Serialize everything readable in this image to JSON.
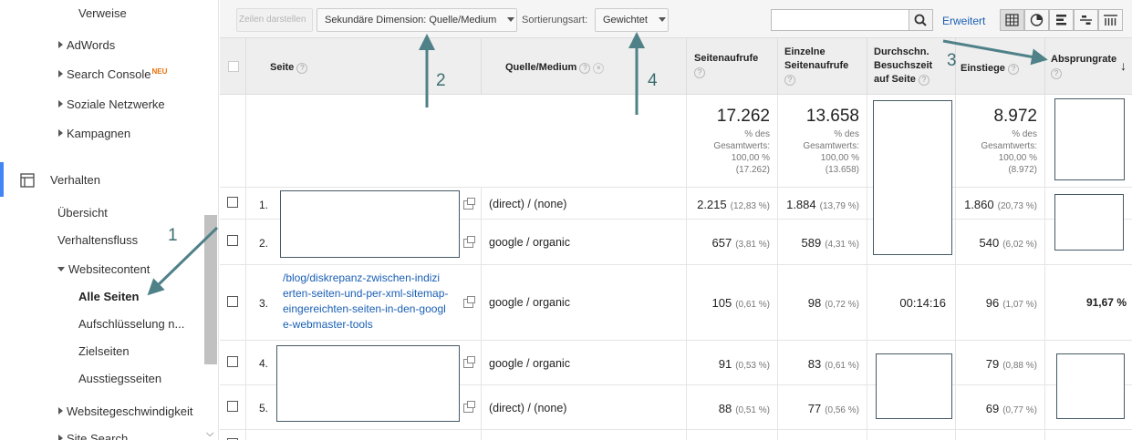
{
  "sidebar": {
    "verweise": "Verweise",
    "adwords": "AdWords",
    "search_console": "Search Console",
    "search_console_badge": "NEU",
    "soziale": "Soziale Netzwerke",
    "kampagnen": "Kampagnen",
    "verhalten": "Verhalten",
    "uebersicht": "Übersicht",
    "verhaltensfluss": "Verhaltensfluss",
    "websitecontent": "Websitecontent",
    "alle_seiten": "Alle Seiten",
    "aufschluesselung": "Aufschlüsselung n...",
    "zielseiten": "Zielseiten",
    "ausstiegsseiten": "Ausstiegsseiten",
    "geschwindigkeit": "Websitegeschwindigkeit",
    "site_search": "Site Search"
  },
  "toolbar": {
    "zeilen": "Zeilen darstellen",
    "sekundaer": "Sekundäre Dimension: Quelle/Medium",
    "sortierungsart_label": "Sortierungsart:",
    "gewichtet": "Gewichtet",
    "search_value": "",
    "erweitert": "Erweitert"
  },
  "table": {
    "headers": {
      "seite": "Seite",
      "quelle": "Quelle/Medium",
      "seitenaufrufe": "Seitenaufrufe",
      "einzelne_1": "Einzelne",
      "einzelne_2": "Seitenaufrufe",
      "durch_1": "Durchschn.",
      "durch_2": "Besuchszeit",
      "durch_3": "auf Seite",
      "einstiege": "Einstiege",
      "absprung": "Absprungrate"
    },
    "totals": {
      "seitenaufrufe": "17.262",
      "einzelne": "13.658",
      "einstiege": "8.972",
      "sub_line1": "% des",
      "sub_line2": "Gesamtwerts:",
      "sub_line3": "100,00 %",
      "seitenaufrufe_total": "(17.262)",
      "einzelne_total": "(13.658)",
      "einstiege_total": "(8.972)"
    },
    "rows": [
      {
        "idx": "1.",
        "source": "(direct) / (none)",
        "pv": "2.215",
        "pv_pct": "(12,83 %)",
        "upv": "1.884",
        "upv_pct": "(13,79 %)",
        "ent": "1.860",
        "ent_pct": "(20,73 %)"
      },
      {
        "idx": "2.",
        "source": "google / organic",
        "pv": "657",
        "pv_pct": "(3,81 %)",
        "upv": "589",
        "upv_pct": "(4,31 %)",
        "ent": "540",
        "ent_pct": "(6,02 %)"
      },
      {
        "idx": "3.",
        "page_l1": "/blog/diskrepanz-zwischen-indizi",
        "page_l2": "erten-seiten-und-per-xml-sitemap-",
        "page_l3": "eingereichten-seiten-in-den-googl",
        "page_l4": "e-webmaster-tools",
        "source": "google / organic",
        "pv": "105",
        "pv_pct": "(0,61 %)",
        "upv": "98",
        "upv_pct": "(0,72 %)",
        "time": "00:14:16",
        "ent": "96",
        "ent_pct": "(1,07 %)",
        "bounce": "91,67 %"
      },
      {
        "idx": "4.",
        "source": "google / organic",
        "pv": "91",
        "pv_pct": "(0,53 %)",
        "upv": "83",
        "upv_pct": "(0,61 %)",
        "ent": "79",
        "ent_pct": "(0,88 %)"
      },
      {
        "idx": "5.",
        "source": "(direct) / (none)",
        "pv": "88",
        "pv_pct": "(0,51 %)",
        "upv": "77",
        "upv_pct": "(0,56 %)",
        "ent": "69",
        "ent_pct": "(0,77 %)"
      }
    ]
  },
  "annotations": {
    "a1": "1",
    "a2": "2",
    "a3": "3",
    "a4": "4"
  },
  "colors": {
    "accent": "#4285f4",
    "arrow": "#4f8188",
    "link": "#1a5fb4"
  }
}
